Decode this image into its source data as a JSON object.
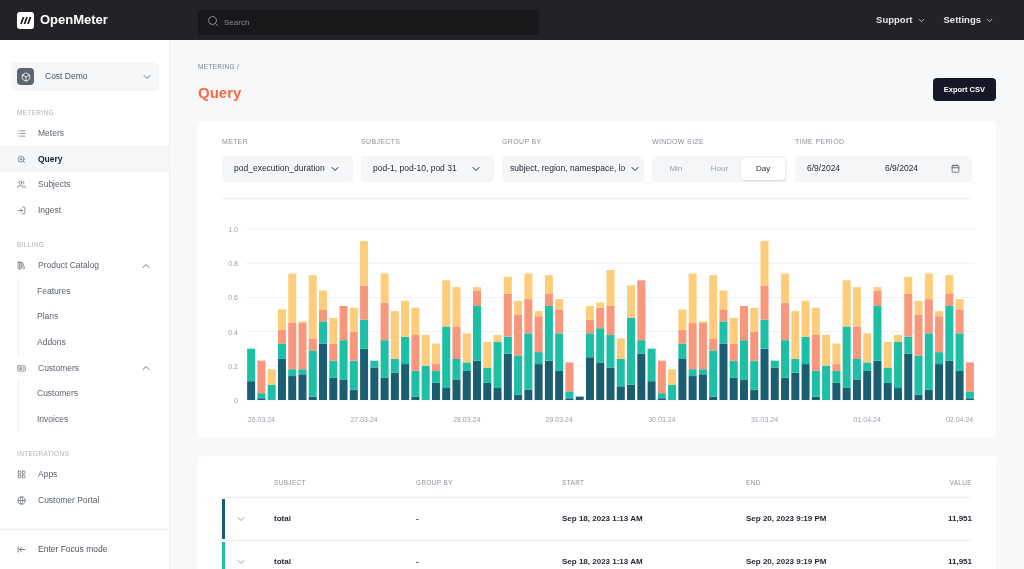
{
  "topbar": {
    "logo": "OpenMeter",
    "search": {
      "placeholder": "Search"
    },
    "menus": [
      {
        "label": "Support"
      },
      {
        "label": "Settings"
      }
    ]
  },
  "sidebar": {
    "workspace": "Cost Demo",
    "sections": [
      {
        "title": "METERING",
        "items": [
          {
            "label": "Meters",
            "selected": false
          },
          {
            "label": "Query",
            "selected": true
          },
          {
            "label": "Subjects",
            "selected": false
          },
          {
            "label": "Ingest",
            "selected": false
          }
        ]
      },
      {
        "title": "BILLING",
        "items": [
          {
            "label": "Product Catalog",
            "selected": false,
            "expanded": true,
            "children": [
              {
                "label": "Features",
                "selected": false
              },
              {
                "label": "Plans",
                "selected": false
              },
              {
                "label": "Addons",
                "selected": false
              }
            ]
          },
          {
            "label": "Customers",
            "selected": false,
            "expanded": true,
            "children": [
              {
                "label": "Customers",
                "selected": false
              },
              {
                "label": "Invoices",
                "selected": false
              }
            ]
          }
        ]
      },
      {
        "title": "INTEGRATIONS",
        "items": [
          {
            "label": "Apps",
            "selected": false
          },
          {
            "label": "Customer Portal",
            "selected": false
          }
        ]
      }
    ],
    "footer": "Enter Focus mode"
  },
  "breadcrumb": "METERING /",
  "title": "Query",
  "export_button": "Export CSV",
  "filters": {
    "meter": {
      "label": "METER",
      "value": "pod_execution_duration"
    },
    "subjects": {
      "label": "SUBJECTS",
      "value": "pod-1, pod-10, pod 31"
    },
    "group_by": {
      "label": "GROUP BY",
      "value": "subject, region, namespace, lo"
    },
    "window_size": {
      "label": "WINDOW SIZE",
      "options": [
        {
          "label": "Min",
          "selected": false
        },
        {
          "label": "Hour",
          "selected": false
        },
        {
          "label": "Day",
          "selected": true
        }
      ]
    },
    "time_period": {
      "label": "TIME PERIOD",
      "from": "6/9/2024",
      "to": "6/9/2024"
    }
  },
  "chart_data": {
    "type": "bar",
    "stacked": true,
    "grid": true,
    "ylim": [
      0,
      1
    ],
    "categories": [
      null,
      "26.03.24",
      null,
      null,
      null,
      null,
      null,
      null,
      null,
      null,
      null,
      "27.03.24",
      null,
      null,
      null,
      null,
      null,
      null,
      null,
      null,
      null,
      "28.03.24",
      null,
      null,
      null,
      null,
      null,
      null,
      null,
      null,
      "29.03.24",
      null,
      null,
      null,
      null,
      null,
      null,
      null,
      null,
      null,
      "30.03.24",
      null,
      null,
      null,
      null,
      null,
      null,
      null,
      null,
      null,
      "31.03.24",
      null,
      null,
      null,
      null,
      null,
      null,
      null,
      null,
      null,
      "01.04.24",
      null,
      null,
      null,
      null,
      null,
      null,
      null,
      null,
      "02.04.24",
      null
    ],
    "yticks": [
      {
        "value": 0,
        "label": "0"
      },
      {
        "value": 0.2,
        "label": "0.2"
      },
      {
        "value": 0.4,
        "label": "0.4"
      },
      {
        "value": 0.6,
        "label": "0.6"
      },
      {
        "value": 0.8,
        "label": "0.8"
      },
      {
        "value": 1,
        "label": "1.0"
      }
    ],
    "series": [
      {
        "color": "#1b5e72",
        "values": [
          0.11,
          0.01,
          0,
          0.24,
          0.14,
          0.15,
          0.02,
          0.33,
          0.13,
          0.12,
          0.06,
          0.3,
          0.19,
          0.13,
          0.16,
          0.21,
          0.02,
          0,
          0.1,
          0.07,
          0.12,
          0.17,
          0.23,
          0.1,
          0.07,
          0.27,
          0.03,
          0.06,
          0.21,
          0.23,
          0.17,
          0.01,
          0.02,
          0.25,
          0.22,
          0.19,
          0.08,
          0.09,
          0.27,
          0.11,
          0.01,
          0,
          0.24,
          0.14,
          0.15,
          0.02,
          0.33,
          0.13,
          0.12,
          0.06,
          0.3,
          0.19,
          0.13,
          0.16,
          0.21,
          0.02,
          0,
          0.1,
          0.07,
          0.12,
          0.17,
          0.23,
          0.1,
          0.07,
          0.27,
          0.03,
          0.06,
          0.21,
          0.23,
          0.17,
          0.01
        ]
      },
      {
        "color": "#1dbfa5",
        "values": [
          0.19,
          0.03,
          0.09,
          0.09,
          0.04,
          0.03,
          0.27,
          0.13,
          0.1,
          0.23,
          0.17,
          0.17,
          0.04,
          0.22,
          0.08,
          0.16,
          0.15,
          0.2,
          0.07,
          0.36,
          0.12,
          0.05,
          0.32,
          0.09,
          0.27,
          0.1,
          0.23,
          0.33,
          0.07,
          0.32,
          0.22,
          0.04,
          0,
          0.14,
          0.2,
          0.19,
          0.16,
          0.39,
          0.08,
          0.19,
          0.03,
          0.09,
          0.09,
          0.04,
          0.03,
          0.27,
          0.13,
          0.1,
          0.23,
          0.17,
          0.17,
          0.04,
          0.22,
          0.08,
          0.16,
          0.15,
          0.2,
          0.07,
          0.36,
          0.12,
          0.05,
          0.32,
          0.09,
          0.27,
          0.1,
          0.23,
          0.33,
          0.07,
          0.32,
          0.22,
          0.04
        ]
      },
      {
        "color": "#f9977d",
        "values": [
          0,
          0.19,
          0,
          0.08,
          0.27,
          0.27,
          0.07,
          0.07,
          0.1,
          0.2,
          0.17,
          0.2,
          0,
          0.22,
          0,
          0,
          0.21,
          0,
          0.04,
          0,
          0.19,
          0,
          0.09,
          0,
          0,
          0.25,
          0.24,
          0.2,
          0.21,
          0.07,
          0.14,
          0.17,
          0,
          0.08,
          0.12,
          0.17,
          0,
          0,
          0.35,
          0,
          0.19,
          0,
          0.08,
          0.27,
          0.27,
          0.07,
          0.07,
          0.1,
          0.2,
          0.17,
          0.2,
          0,
          0.22,
          0,
          0,
          0.21,
          0,
          0.04,
          0,
          0.19,
          0,
          0.09,
          0,
          0,
          0.25,
          0.24,
          0.2,
          0.21,
          0.07,
          0.14,
          0.17
        ]
      },
      {
        "color": "#fdcd7b",
        "values": [
          0,
          0,
          0.09,
          0.12,
          0.29,
          0.01,
          0.37,
          0.11,
          0.15,
          0,
          0.14,
          0.26,
          0,
          0.17,
          0.28,
          0.21,
          0.16,
          0.18,
          0.12,
          0.27,
          0.23,
          0.17,
          0.02,
          0.15,
          0.04,
          0.1,
          0.08,
          0.15,
          0.03,
          0.11,
          0.06,
          0,
          0,
          0.08,
          0.03,
          0.21,
          0.12,
          0.19,
          0,
          0,
          0,
          0.09,
          0.12,
          0.29,
          0.01,
          0.37,
          0.11,
          0.15,
          0,
          0.14,
          0.26,
          0,
          0.17,
          0.28,
          0.21,
          0.16,
          0.18,
          0.12,
          0.27,
          0.23,
          0.17,
          0.02,
          0.15,
          0.04,
          0.1,
          0.08,
          0.15,
          0.03,
          0.11,
          0.06,
          0
        ]
      }
    ]
  },
  "table": {
    "columns": [
      "SUBJECT",
      "GROUP BY",
      "START",
      "END",
      "VALUE"
    ],
    "rows": [
      {
        "color": "#1b5e72",
        "expanded": false,
        "subject": "total",
        "group_by": "-",
        "start": "Sep 18, 2023 1:13 AM",
        "end": "Sep 20, 2023 9:19 PM",
        "value": "11,951"
      },
      {
        "color": "#1dbfa5",
        "expanded": false,
        "subject": "total",
        "group_by": "-",
        "start": "Sep 18, 2023 1:13 AM",
        "end": "Sep 20, 2023 9:19 PM",
        "value": "11,951"
      }
    ]
  }
}
